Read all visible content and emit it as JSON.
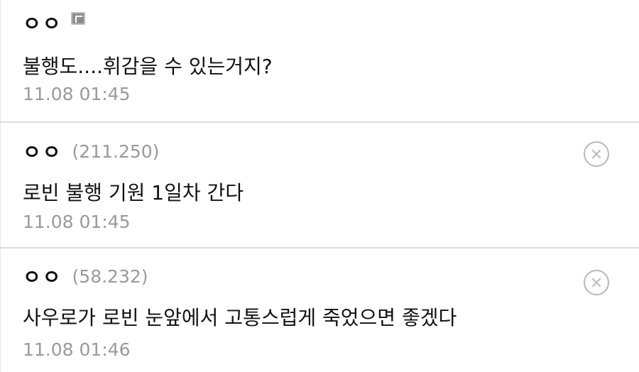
{
  "comments": [
    {
      "nick": "ㅇㅇ",
      "ip": "",
      "text": "불행도....휘감을 수 있는거지?",
      "date": "11.08 01:45",
      "has_delete": false,
      "has_member_badge": true
    },
    {
      "nick": "ㅇㅇ",
      "ip": "(211.250)",
      "text": "로빈 불행 기원 1일차 간다",
      "date": "11.08 01:45",
      "has_delete": true
    },
    {
      "nick": "ㅇㅇ",
      "ip": "(58.232)",
      "text": "사우로가 로빈 눈앞에서 고통스럽게 죽었으면 좋겠다",
      "date": "11.08 01:46",
      "has_delete": true
    }
  ],
  "icons": {
    "member_badge": "member-badge-icon",
    "delete": "delete-circle-x-icon"
  },
  "colors": {
    "text": "#111111",
    "meta": "#9a9a9a",
    "divider": "#dcdcdc",
    "delete_icon": "#b8b8b8"
  }
}
